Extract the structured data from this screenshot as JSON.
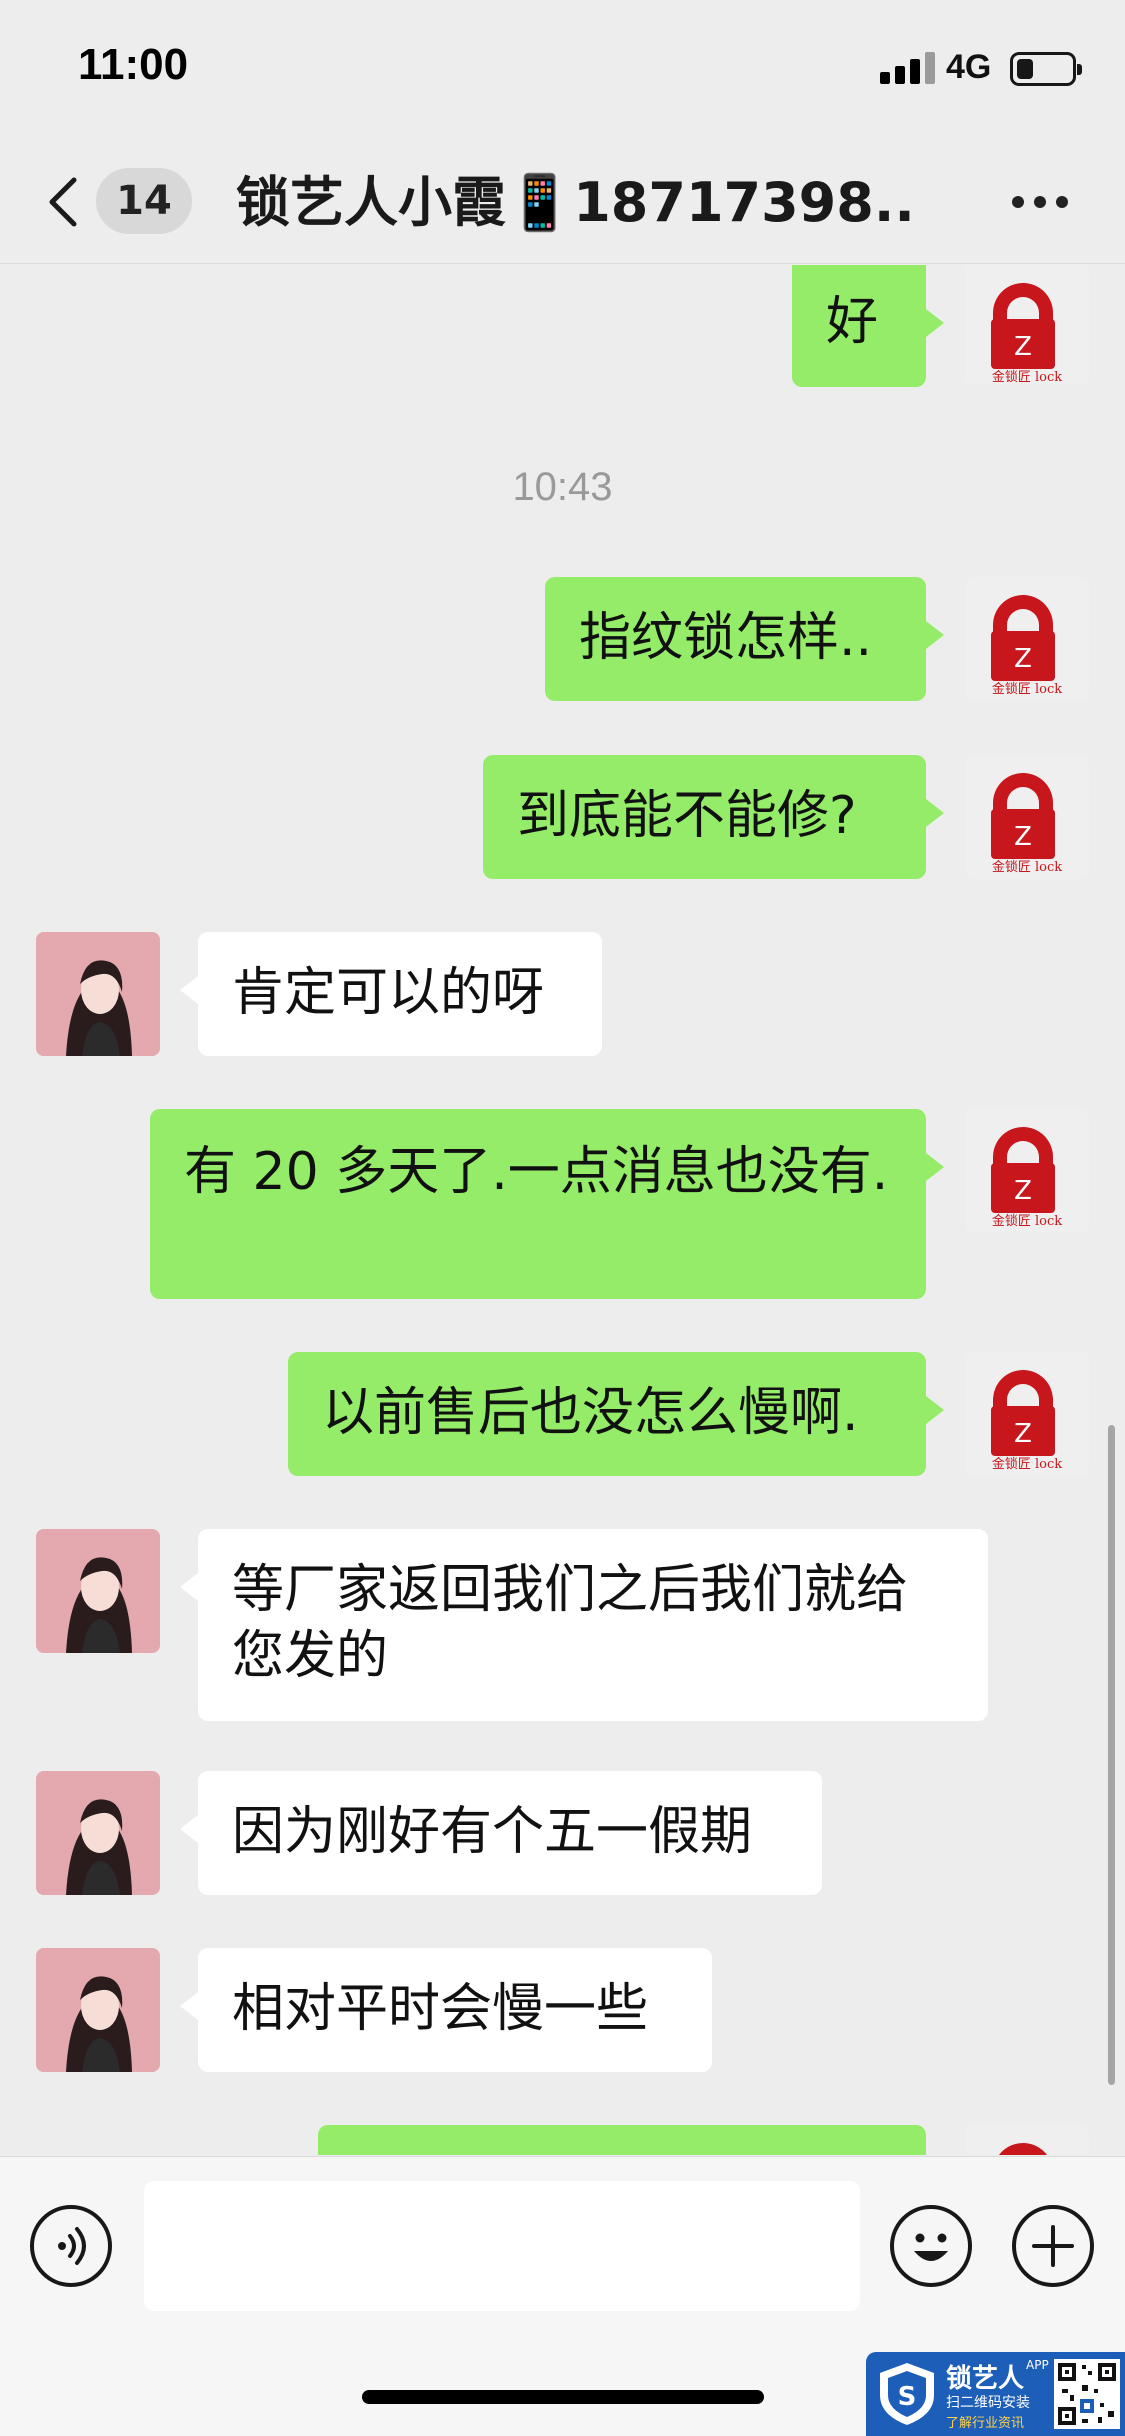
{
  "status_bar": {
    "time": "11:00",
    "network": "4G",
    "battery_level": 0.3
  },
  "nav": {
    "unread_count": "14",
    "title": "锁艺人小霞📱18717398..."
  },
  "messages": [
    {
      "sender": "me",
      "text": "好"
    },
    {
      "type": "time",
      "text": "10:43"
    },
    {
      "sender": "me",
      "text": "指纹锁怎样.."
    },
    {
      "sender": "me",
      "text": "到底能不能修?"
    },
    {
      "sender": "them",
      "text": "肯定可以的呀"
    },
    {
      "sender": "me",
      "text": "有 20 多天了.一点消息也没有."
    },
    {
      "sender": "me",
      "text": "以前售后也没怎么慢啊."
    },
    {
      "sender": "them",
      "text": "等厂家返回我们之后我们就给您发的"
    },
    {
      "sender": "them",
      "text": "因为刚好有个五一假期"
    },
    {
      "sender": "them",
      "text": "相对平时会慢一些"
    },
    {
      "sender": "me",
      "text": ""
    }
  ],
  "avatar_me": {
    "logo_text": "金锁匠 lock",
    "logo_letter": "Z"
  },
  "input": {
    "placeholder": ""
  },
  "colors": {
    "sent_bubble": "#95ec69",
    "received_bubble": "#ffffff",
    "background": "#ededed",
    "logo_red": "#c8161d"
  },
  "watermark": {
    "brand": "锁艺人",
    "tag": "APP",
    "line1": "扫二维码安装",
    "line2": "了解行业资讯"
  }
}
